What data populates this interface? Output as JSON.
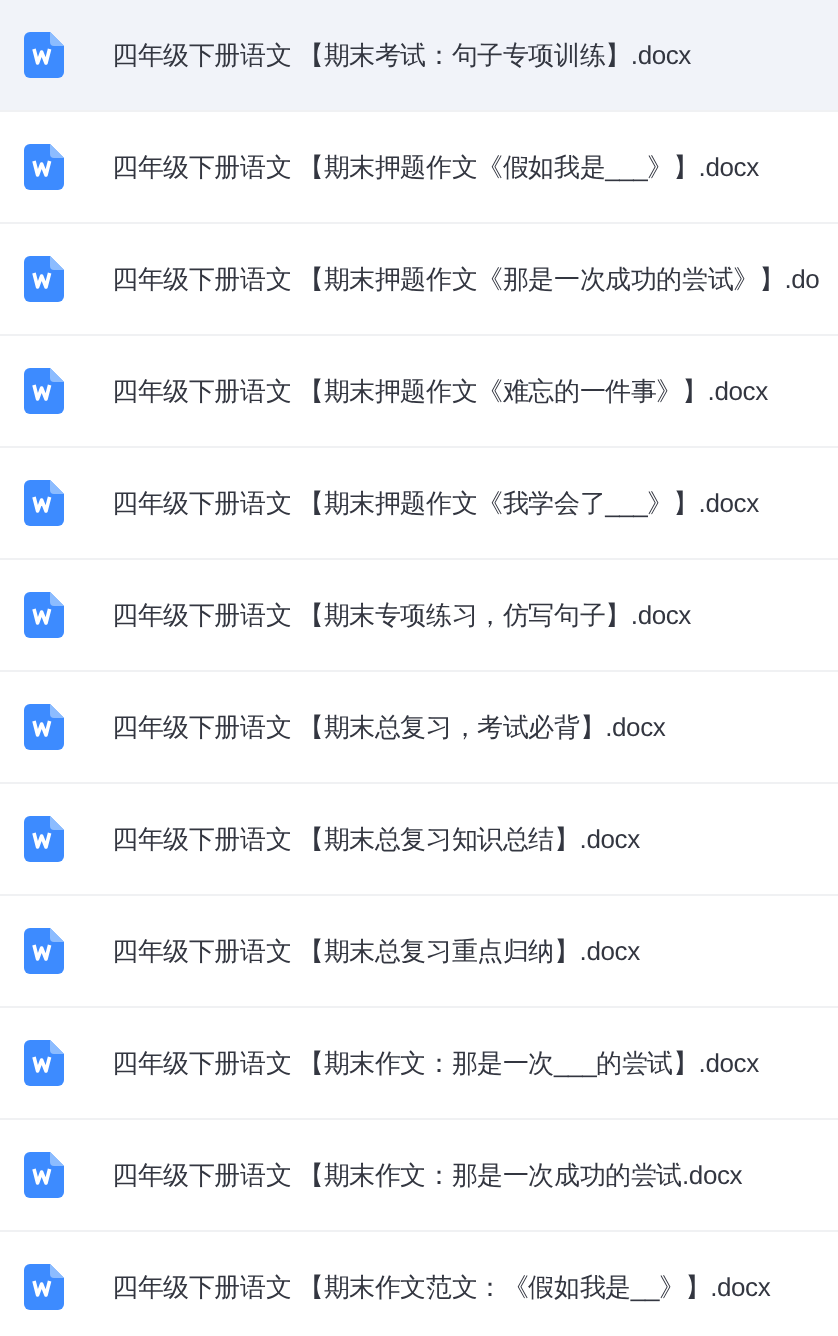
{
  "files": [
    {
      "name": "四年级下册语文 【期末考试：句子专项训练】.docx",
      "selected": true
    },
    {
      "name": "四年级下册语文 【期末押题作文《假如我是___》】.docx",
      "selected": false
    },
    {
      "name": "四年级下册语文 【期末押题作文《那是一次成功的尝试》】.do",
      "selected": false
    },
    {
      "name": "四年级下册语文 【期末押题作文《难忘的一件事》】.docx",
      "selected": false
    },
    {
      "name": "四年级下册语文 【期末押题作文《我学会了___》】.docx",
      "selected": false
    },
    {
      "name": "四年级下册语文 【期末专项练习，仿写句子】.docx",
      "selected": false
    },
    {
      "name": "四年级下册语文 【期末总复习，考试必背】.docx",
      "selected": false
    },
    {
      "name": "四年级下册语文 【期末总复习知识总结】.docx",
      "selected": false
    },
    {
      "name": "四年级下册语文 【期末总复习重点归纳】.docx",
      "selected": false
    },
    {
      "name": "四年级下册语文 【期末作文：那是一次___的尝试】.docx",
      "selected": false
    },
    {
      "name": "四年级下册语文 【期末作文：那是一次成功的尝试.docx",
      "selected": false
    },
    {
      "name": "四年级下册语文 【期末作文范文：《假如我是__》】.docx",
      "selected": false
    }
  ]
}
